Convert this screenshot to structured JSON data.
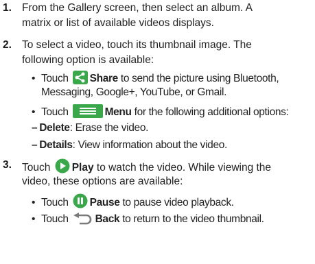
{
  "steps": [
    {
      "number": "1.",
      "lines": [
        "From the Gallery screen, then select an album. A",
        "matrix or list of available videos displays."
      ]
    },
    {
      "number": "2.",
      "lines": [
        "To select a video, touch its thumbnail image. The",
        "following option is available:"
      ],
      "bullets": [
        {
          "pre": "Touch",
          "icon": "share-icon",
          "bold": "Share",
          "post": " to send the picture using Bluetooth,",
          "cont": "Messaging, Google+, YouTube, or Gmail."
        },
        {
          "pre": "Touch",
          "icon": "menu-icon",
          "bold": "Menu",
          "post": " for the following additional options:"
        }
      ],
      "subitems": [
        {
          "dash": "–",
          "bold": "Delete",
          "post": ": Erase the video."
        },
        {
          "dash": "–",
          "bold": "Details",
          "post": ": View information about the video."
        }
      ]
    },
    {
      "number": "3.",
      "pre": "Touch",
      "icon": "play-icon",
      "bold": "Play",
      "post": " to watch the video. While viewing the",
      "line2": "video, these options are available:",
      "bullets": [
        {
          "pre": "Touch",
          "icon": "pause-icon",
          "bold": "Pause",
          "post": " to pause video playback."
        },
        {
          "pre": "Touch",
          "icon": "back-icon",
          "bold": "Back",
          "post": " to return to the video thumbnail."
        }
      ]
    }
  ],
  "colors": {
    "icon_green": "#3aa84a",
    "icon_gray": "#7a7a7a",
    "icon_dark": "#555555"
  }
}
